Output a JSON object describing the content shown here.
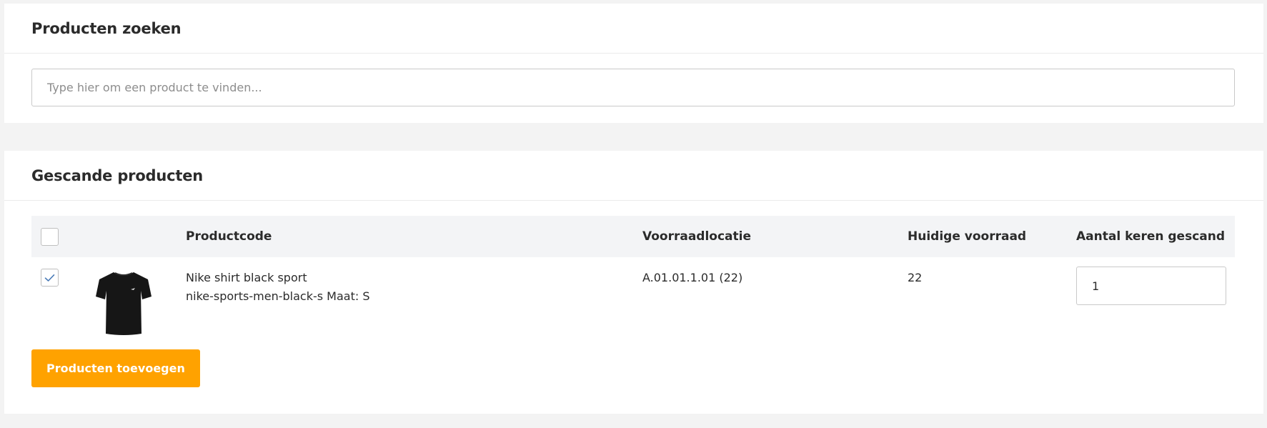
{
  "search_card": {
    "title": "Producten zoeken",
    "search_placeholder": "Type hier om een product te vinden...",
    "search_value": ""
  },
  "scanned_card": {
    "title": "Gescande producten",
    "columns": {
      "code": "Productcode",
      "location": "Voorraadlocatie",
      "stock": "Huidige voorraad",
      "scanned": "Aantal keren gescand"
    },
    "select_all_checked": false,
    "rows": [
      {
        "checked": true,
        "image_icon": "black-tshirt-icon",
        "name": "Nike shirt black sport",
        "code_line": "nike-sports-men-black-s Maat: S",
        "location": "A.01.01.1.01 (22)",
        "stock": "22",
        "scanned_count": "1"
      }
    ],
    "add_button_label": "Producten toevoegen"
  },
  "colors": {
    "accent": "#ffa200",
    "header_bg": "#f3f4f6",
    "page_bg": "#f3f3f3",
    "checkbox_check": "#4a7bb7"
  }
}
